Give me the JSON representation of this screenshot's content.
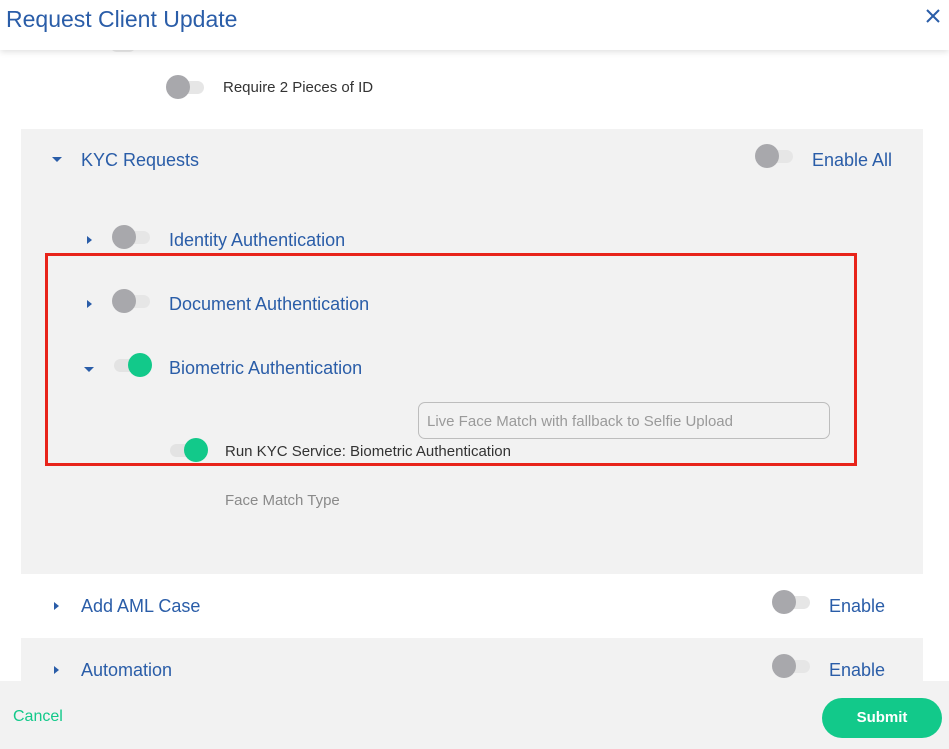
{
  "dialog": {
    "title": "Request Client Update",
    "close_icon": "close-icon"
  },
  "options": {
    "require_two_ids": {
      "label": "Require 2 Pieces of ID",
      "enabled": false
    }
  },
  "kyc": {
    "section_label": "KYC Requests",
    "expanded": true,
    "enable_all_label": "Enable All",
    "enable_all": false,
    "items": [
      {
        "label": "Identity Authentication",
        "expanded": false,
        "enabled": false
      },
      {
        "label": "Document Authentication",
        "expanded": false,
        "enabled": false
      },
      {
        "label": "Biometric Authentication",
        "expanded": true,
        "enabled": true
      }
    ],
    "biometric": {
      "run_service_label": "Run KYC Service: Biometric Authentication",
      "run_service_enabled": true,
      "face_match_label": "Face Match Type",
      "face_match_value": "Live Face Match with fallback to Selfie Upload"
    }
  },
  "aml": {
    "label": "Add AML Case",
    "enable_label": "Enable",
    "enabled": false
  },
  "automation": {
    "label": "Automation",
    "enable_label": "Enable",
    "enabled": false
  },
  "footer": {
    "cancel_label": "Cancel",
    "submit_label": "Submit"
  },
  "colors": {
    "brand_blue": "#2a5da8",
    "accent_green": "#12c98a",
    "highlight_red": "#e8241a",
    "panel_gray": "#f2f2f2"
  }
}
